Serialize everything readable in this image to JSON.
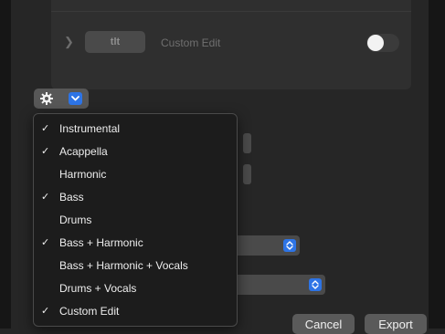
{
  "effect_row": {
    "tag_label": "tlt",
    "label": "Custom Edit",
    "toggle_on": true
  },
  "menu": {
    "items": [
      {
        "label": "Instrumental",
        "checked": true
      },
      {
        "label": "Acappella",
        "checked": true
      },
      {
        "label": "Harmonic",
        "checked": false
      },
      {
        "label": "Bass",
        "checked": true
      },
      {
        "label": "Drums",
        "checked": false
      },
      {
        "label": "Bass + Harmonic",
        "checked": true
      },
      {
        "label": "Bass + Harmonic + Vocals",
        "checked": false
      },
      {
        "label": "Drums + Vocals",
        "checked": false
      },
      {
        "label": "Custom Edit",
        "checked": true
      }
    ]
  },
  "footer": {
    "cancel_label": "Cancel",
    "export_label": "Export"
  },
  "icons": {
    "chevron": "chevron-right-icon",
    "gear": "gear-icon",
    "dropdown": "chevron-down-icon",
    "check": "checkmark-icon"
  },
  "colors": {
    "accent": "#2d74e6",
    "background": "#262626",
    "menu_background": "#1c1c1c"
  }
}
